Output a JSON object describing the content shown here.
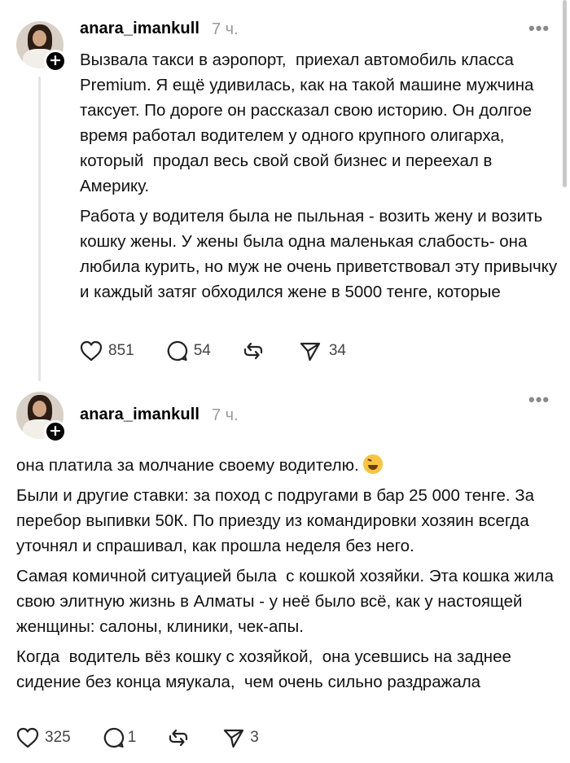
{
  "posts": [
    {
      "username": "anara_imankull",
      "time": "7 ч.",
      "more": "•••",
      "paragraphs": [
        "Вызвала такси в аэропорт,  приехал автомобиль класса Premium. Я ещё удивилась, как на такой машине мужчина таксует. По дороге он рассказал свою историю. Он долгое время работал водителем у одного крупного олигарха,  который  продал весь свой свой бизнес и переехал в Америку.",
        "Работа у водителя была не пыльная - возить жену и возить кошку жены. У жены была одна маленькая слабость- она любила курить, но муж не очень приветствовал эту привычку и каждый затяг обходился жене в 5000 тенге, которые"
      ],
      "likes": "851",
      "comments": "54",
      "shares": "34"
    },
    {
      "username": "anara_imankull",
      "time": "7 ч.",
      "more": "•••",
      "first_line": "она платила за молчание своему водителю.",
      "paragraphs": [
        "Были и другие ставки: за поход с подругами в бар 25 000 тенге. За перебор выпивки 50К. По приезду из командировки хозяин всегда уточнял и спрашивал, как прошла неделя без него.",
        "Самая комичной ситуацией была  с кошкой хозяйки. Эта кошка жила свою элитную жизнь в Алматы - у неё было всё, как у настоящей женщины: салоны, клиники, чек-апы.",
        "Когда  водитель вёз кошку с хозяйкой,  она усевшись на заднее сидение без конца мяукала,  чем очень сильно раздражала"
      ],
      "likes": "325",
      "comments": "1",
      "shares": "3"
    }
  ],
  "icons": {
    "like": "heart-icon",
    "comment": "comment-bubble-icon",
    "repost": "repost-icon",
    "share": "share-send-icon",
    "follow": "plus-icon",
    "emoji": "grinning-squinting-face-emoji"
  }
}
